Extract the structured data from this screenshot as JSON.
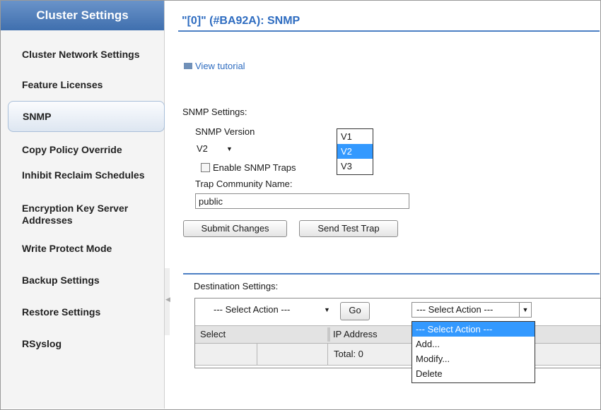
{
  "sidebar": {
    "header": "Cluster Settings",
    "items": [
      {
        "label": "Cluster Network Settings"
      },
      {
        "label": "Feature Licenses"
      },
      {
        "label": "SNMP"
      },
      {
        "label": "Copy Policy Override"
      },
      {
        "label": "Inhibit Reclaim Schedules"
      },
      {
        "label": "Encryption Key Server Addresses"
      },
      {
        "label": "Write Protect Mode"
      },
      {
        "label": "Backup Settings"
      },
      {
        "label": "Restore Settings"
      },
      {
        "label": "RSyslog"
      }
    ],
    "active": "SNMP"
  },
  "main": {
    "title": "\"[0]\" (#BA92A): SNMP",
    "tutorial_link": "View tutorial",
    "snmp_settings_label": "SNMP Settings:",
    "snmp_version_label": "SNMP Version",
    "snmp_version_value": "V2",
    "snmp_version_options": [
      "V1",
      "V2",
      "V3"
    ],
    "enable_traps_label": "Enable SNMP Traps",
    "enable_traps_checked": false,
    "trap_community_label": "Trap Community Name:",
    "trap_community_value": "public",
    "submit_button": "Submit Changes",
    "test_trap_button": "Send Test Trap",
    "destination_label": "Destination Settings:",
    "action_select_1": "--- Select Action ---",
    "go_button": "Go",
    "action_select_2": "--- Select Action ---",
    "action_options": [
      "--- Select Action ---",
      "Add...",
      "Modify...",
      "Delete"
    ],
    "grid_columns": [
      "Select",
      "IP Address"
    ],
    "grid_total": "Total: 0"
  },
  "colors": {
    "accent": "#2e6cc0",
    "header_bg": "#4a7ab9",
    "selection": "#3399ff"
  }
}
